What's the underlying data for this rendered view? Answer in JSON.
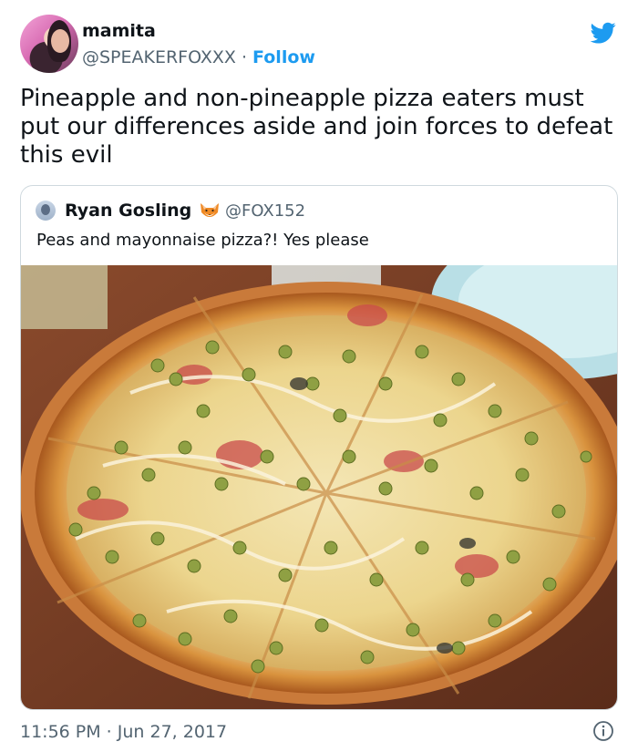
{
  "author": {
    "name": "mamita",
    "handle": "@SPEAKERFOXXX",
    "separator": "·",
    "follow_label": "Follow"
  },
  "tweet": {
    "text": "Pineapple and non-pineapple pizza eaters must put our differences aside and join forces to defeat this evil"
  },
  "quoted": {
    "name": "Ryan Gosling",
    "emoji_icon": "fox-emoji-icon",
    "handle": "@FOX152",
    "text": "Peas and mayonnaise pizza?! Yes please",
    "media_icon": "pizza-photo"
  },
  "footer": {
    "timestamp": "11:56 PM · Jun 27, 2017",
    "info_icon": "info-icon"
  },
  "colors": {
    "twitter_blue": "#1d9bf0",
    "secondary_text": "#536471",
    "border": "#cfd9de"
  }
}
